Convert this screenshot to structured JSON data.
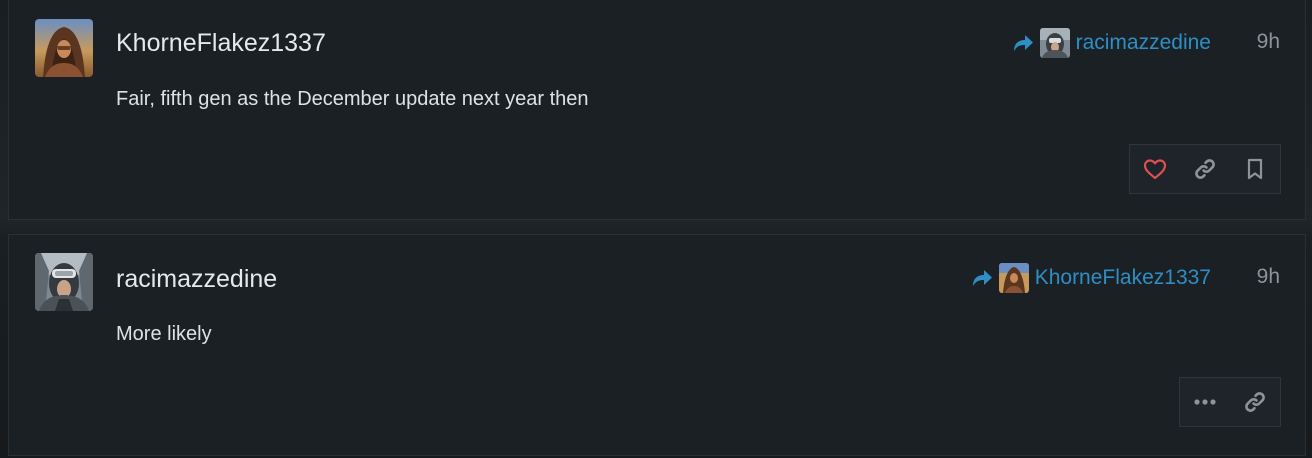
{
  "posts": [
    {
      "username": "KhorneFlakez1337",
      "text": "Fair, fifth gen as the December update next year then",
      "reply_to": "racimazzedine",
      "timestamp": "9h",
      "actions": [
        "like-icon",
        "link-icon",
        "bookmark-icon"
      ]
    },
    {
      "username": "racimazzedine",
      "text": "More likely",
      "reply_to": "KhorneFlakez1337",
      "timestamp": "9h",
      "actions": [
        "more-icon",
        "link-icon"
      ]
    }
  ],
  "colors": {
    "background": "#16191b",
    "post_bg": "#1b2024",
    "link_blue": "#2e8fc4",
    "like_red": "#e0504f",
    "muted_icon": "#8d9398",
    "text": "#dfe1e3"
  }
}
